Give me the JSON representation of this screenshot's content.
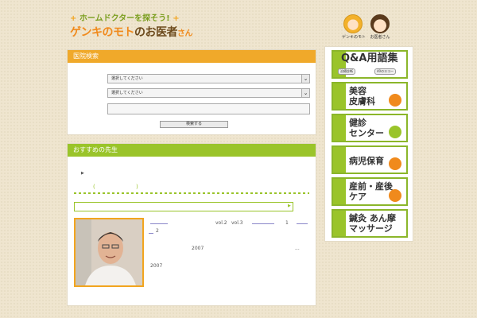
{
  "header": {
    "tagline": "ホームドクターを探そう!",
    "logo_part1": "ゲンキのモト",
    "logo_part2": "の",
    "logo_part3": "お医者",
    "logo_part4": "さん",
    "icon1_caption": "ゲンキのモト",
    "icon2_caption": "お医者さん"
  },
  "search": {
    "title": "医院検索",
    "select1_value": "選択してください",
    "select2_value": "選択してください",
    "text_value": "",
    "submit_label": "検索する"
  },
  "doctor": {
    "title": "おすすめの先生",
    "meta1": "vol.2",
    "meta2": "vol.3",
    "meta3": "1",
    "meta4": "2",
    "meta5": "2007",
    "meta6": "...",
    "meta7": "2007"
  },
  "nav": {
    "qa": "Q&A用語集",
    "qa_sub1": "治療診断",
    "qa_sub2": "40のエコー",
    "item2": "美容\n皮膚科",
    "item3": "健診\nセンター",
    "item4": "病児保育",
    "item5": "産前・産後\nケア",
    "item6": "鍼灸 あん摩\nマッサージ"
  },
  "colors": {
    "orange": "#f0a92a",
    "green": "#9ac42a",
    "background": "#efe5cf"
  }
}
